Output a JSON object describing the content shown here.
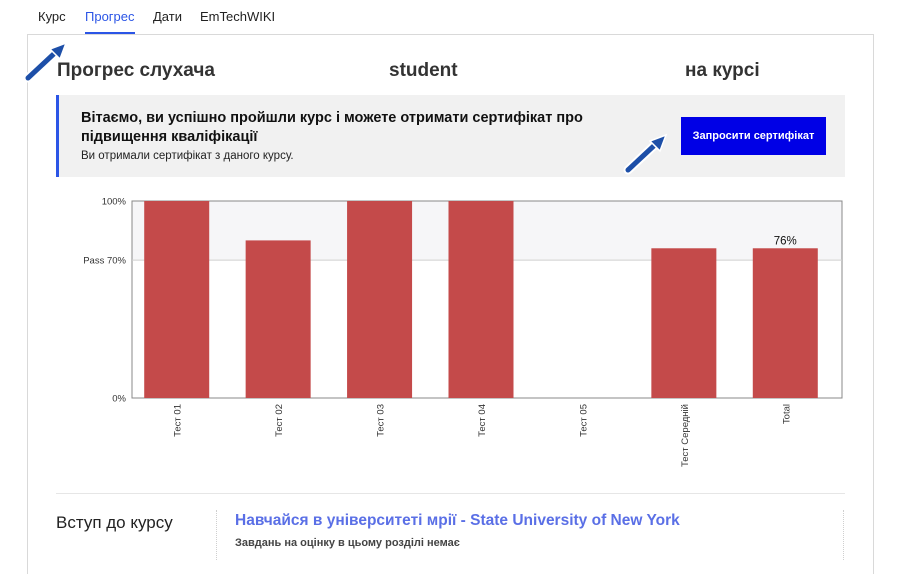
{
  "nav": {
    "tabs": [
      {
        "label": "Курс",
        "active": false
      },
      {
        "label": "Прогрес",
        "active": true
      },
      {
        "label": "Дати",
        "active": false
      },
      {
        "label": "EmTechWIKI",
        "active": false
      }
    ]
  },
  "header": {
    "title_part1": "Прогрес слухача",
    "title_part2": "student",
    "title_part3": "на курсі"
  },
  "certificate": {
    "heading": "Вітаємо, ви успішно пройшли курс і можете отримати сертифікат про підвищення кваліфікації",
    "subtext": "Ви отримали сертифікат з даного курсу.",
    "button_label": "Запросити сертифікат",
    "accent_color": "#2b55e6",
    "button_color": "#0000e6"
  },
  "chart_data": {
    "type": "bar",
    "categories": [
      "Тест 01",
      "Тест 02",
      "Тест 03",
      "Тест 04",
      "Тест 05",
      "Тест Середній",
      "Total"
    ],
    "values": [
      100,
      80,
      100,
      100,
      0,
      76,
      76
    ],
    "ylim": [
      0,
      100
    ],
    "y_ticks": [
      {
        "value": 100,
        "label": "100%"
      },
      {
        "value": 70,
        "label": "Pass 70%"
      },
      {
        "value": 0,
        "label": "0%"
      }
    ],
    "pass_threshold": 70,
    "data_labels": [
      {
        "category": "Total",
        "label": "76%"
      }
    ],
    "bar_color": "#c44a4a",
    "grid": false
  },
  "section": {
    "title": "Вступ до курсу",
    "link": "Навчайся в університеті мрії - State University of New York",
    "note": "Завдань на оцінку в цьому розділі немає"
  }
}
